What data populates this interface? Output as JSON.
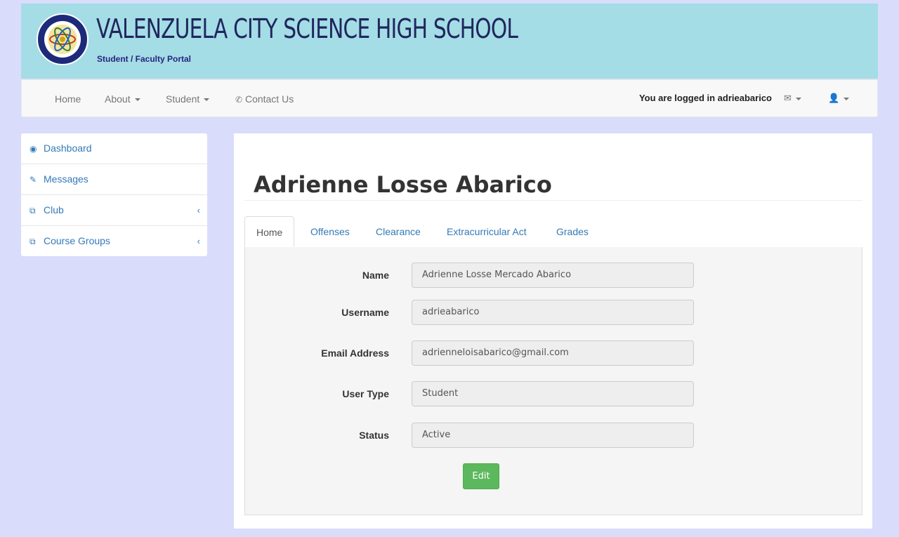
{
  "header": {
    "school_name": "VALENZUELA CITY SCIENCE HIGH SCHOOL",
    "portal_subtitle": "Student / Faculty Portal",
    "logo_text": "VALENZUELA CITY SCIENCE HIGH SCHOOL 2003"
  },
  "navbar": {
    "home": "Home",
    "about": "About",
    "student": "Student",
    "contact": "Contact Us",
    "logged_in_text": "You are logged in adrieabarico"
  },
  "sidebar": {
    "items": [
      {
        "label": "Dashboard",
        "icon": "dashboard-icon"
      },
      {
        "label": "Messages",
        "icon": "edit-icon"
      },
      {
        "label": "Club",
        "icon": "copy-icon",
        "chevron": "‹"
      },
      {
        "label": "Course Groups",
        "icon": "copy-icon",
        "chevron": "‹"
      }
    ]
  },
  "profile": {
    "name": "Adrienne Losse Abarico"
  },
  "tabs": [
    "Home",
    "Offenses",
    "Clearance",
    "Extracurricular Act",
    "Grades"
  ],
  "form": {
    "fields": [
      {
        "label": "Name",
        "value": "Adrienne Losse Mercado Abarico"
      },
      {
        "label": "Username",
        "value": "adrieabarico"
      },
      {
        "label": "Email Address",
        "value": "adrienneloisabarico@gmail.com"
      },
      {
        "label": "User Type",
        "value": "Student"
      },
      {
        "label": "Status",
        "value": "Active"
      }
    ],
    "edit_label": "Edit"
  },
  "colors": {
    "banner": "#a4dde5",
    "page_background": "#d9dcfb",
    "link": "#337ab7",
    "edit_button": "#5cb85c"
  }
}
